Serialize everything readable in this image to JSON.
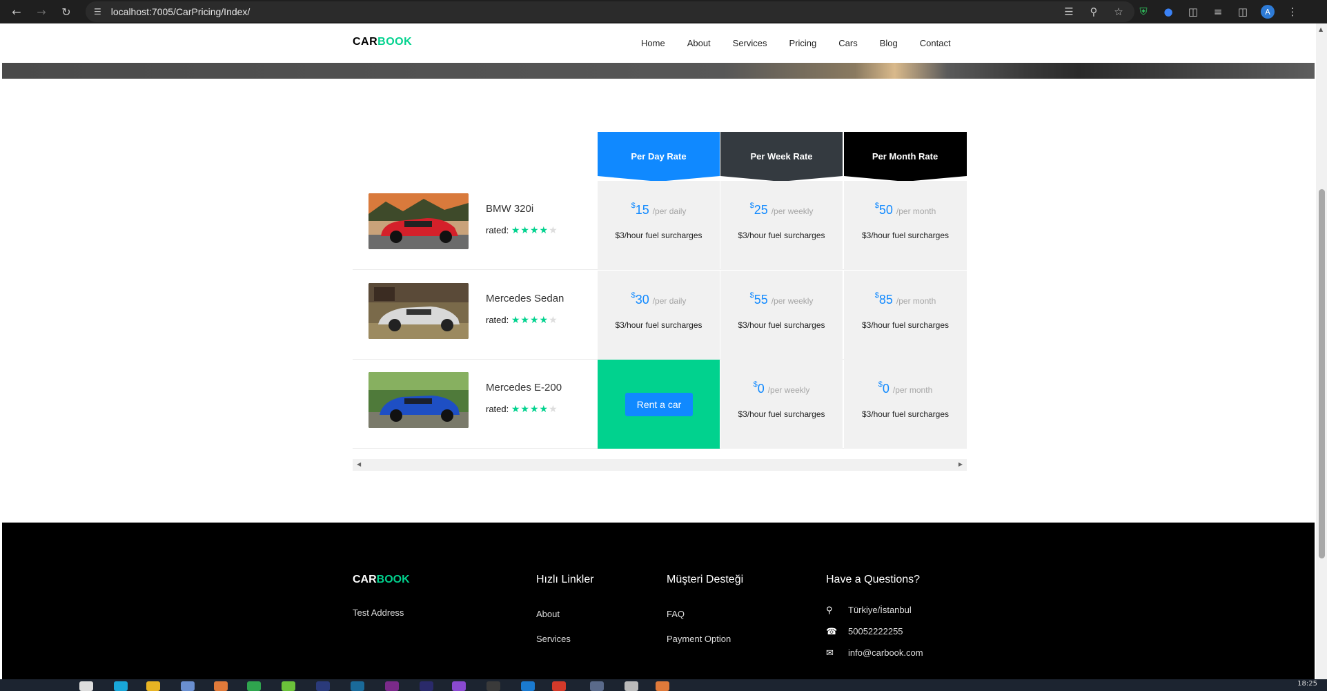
{
  "browser": {
    "url": "localhost:7005/CarPricing/Index/",
    "profile_initial": "A"
  },
  "site": {
    "logo_part1": "CAR",
    "logo_part2": "BOOK",
    "nav": [
      "Home",
      "About",
      "Services",
      "Pricing",
      "Cars",
      "Blog",
      "Contact"
    ]
  },
  "pricing": {
    "headers": [
      "Per Day Rate",
      "Per Week Rate",
      "Per Month Rate"
    ],
    "header_colors": [
      "#1089ff",
      "#343a40",
      "#000000"
    ],
    "rated_label": "rated:",
    "currency": "$",
    "rows": [
      {
        "car": "BMW 320i",
        "stars": 4,
        "day": {
          "amount": "15",
          "unit": "/per daily",
          "surcharge": "$3/hour fuel surcharges"
        },
        "week": {
          "amount": "25",
          "unit": "/per weekly",
          "surcharge": "$3/hour fuel surcharges"
        },
        "month": {
          "amount": "50",
          "unit": "/per month",
          "surcharge": "$3/hour fuel surcharges"
        }
      },
      {
        "car": "Mercedes Sedan",
        "stars": 4,
        "day": {
          "amount": "30",
          "unit": "/per daily",
          "surcharge": "$3/hour fuel surcharges"
        },
        "week": {
          "amount": "55",
          "unit": "/per weekly",
          "surcharge": "$3/hour fuel surcharges"
        },
        "month": {
          "amount": "85",
          "unit": "/per month",
          "surcharge": "$3/hour fuel surcharges"
        }
      },
      {
        "car": "Mercedes E-200",
        "stars": 4,
        "day_button": "Rent a car",
        "week": {
          "amount": "0",
          "unit": "/per weekly",
          "surcharge": "$3/hour fuel surcharges"
        },
        "month": {
          "amount": "0",
          "unit": "/per month",
          "surcharge": "$3/hour fuel surcharges"
        }
      }
    ]
  },
  "footer": {
    "logo_part1": "CAR",
    "logo_part2": "BOOK",
    "address": "Test Address",
    "quick_links_title": "Hızlı Linkler",
    "quick_links": [
      "About",
      "Services"
    ],
    "support_title": "Müşteri Desteği",
    "support_links": [
      "FAQ",
      "Payment Option"
    ],
    "questions_title": "Have a Questions?",
    "location": "Türkiye/İstanbul",
    "phone": "50052222255",
    "email": "info@carbook.com"
  },
  "taskbar": {
    "time": "18:25"
  },
  "colors": {
    "accent_green": "#01d28e",
    "accent_blue": "#1089ff"
  }
}
